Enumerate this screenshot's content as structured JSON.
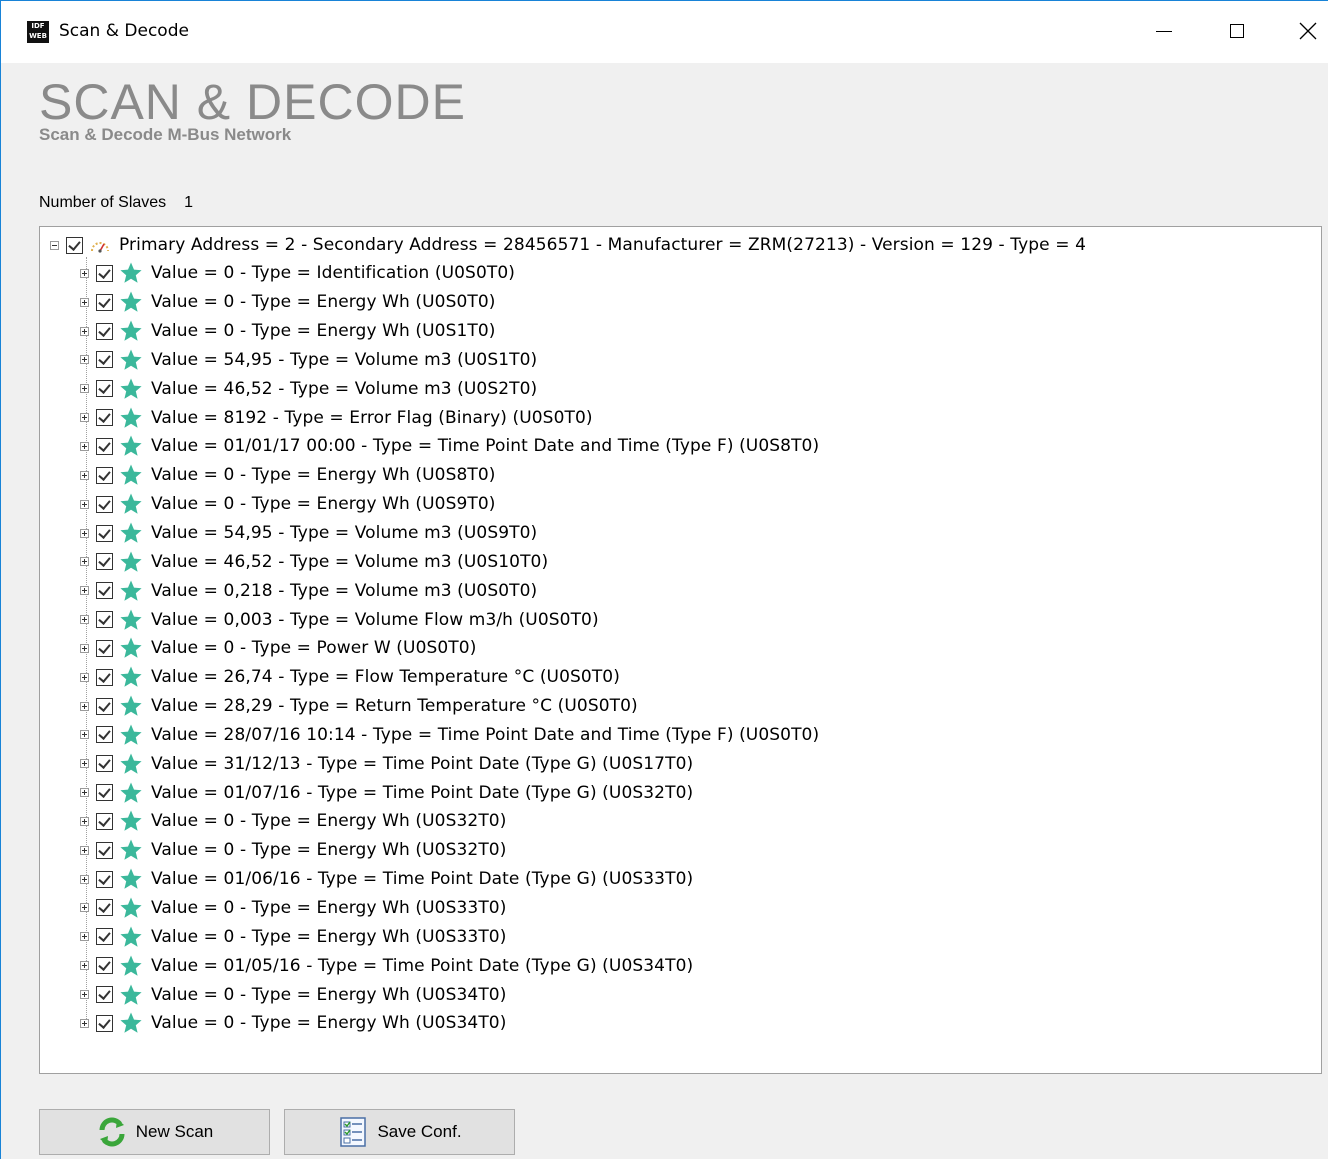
{
  "window": {
    "title": "Scan & Decode",
    "app_icon_lines": [
      "IDF",
      "WEB"
    ],
    "accent": "#1883d7"
  },
  "header": {
    "title": "SCAN & DECODE",
    "subtitle": "Scan & Decode M-Bus Network"
  },
  "slaves": {
    "label": "Number of Slaves",
    "count": "1"
  },
  "tree": {
    "root": "Primary Address = 2 - Secondary Address = 28456571 - Manufacturer = ZRM(27213) - Version = 129 - Type = 4",
    "items": [
      "Value = 0 - Type = Identification (U0S0T0)",
      "Value = 0 - Type = Energy Wh (U0S0T0)",
      "Value = 0 - Type = Energy Wh (U0S1T0)",
      "Value = 54,95 - Type = Volume m3 (U0S1T0)",
      "Value = 46,52 - Type = Volume m3 (U0S2T0)",
      "Value = 8192 - Type = Error Flag (Binary) (U0S0T0)",
      "Value = 01/01/17 00:00 - Type = Time Point Date and Time (Type F) (U0S8T0)",
      "Value = 0 - Type = Energy Wh (U0S8T0)",
      "Value = 0 - Type = Energy Wh (U0S9T0)",
      "Value = 54,95 - Type = Volume m3 (U0S9T0)",
      "Value = 46,52 - Type = Volume m3 (U0S10T0)",
      "Value = 0,218 - Type = Volume m3 (U0S0T0)",
      "Value = 0,003 - Type = Volume Flow m3/h (U0S0T0)",
      "Value = 0 - Type = Power W (U0S0T0)",
      "Value = 26,74 - Type = Flow Temperature °C (U0S0T0)",
      "Value = 28,29 - Type = Return Temperature °C (U0S0T0)",
      "Value = 28/07/16 10:14 - Type = Time Point Date and Time (Type F) (U0S0T0)",
      "Value = 31/12/13 - Type = Time Point Date (Type G) (U0S17T0)",
      "Value = 01/07/16 - Type = Time Point Date (Type G) (U0S32T0)",
      "Value = 0 - Type = Energy Wh (U0S32T0)",
      "Value = 0 - Type = Energy Wh (U0S32T0)",
      "Value = 01/06/16 - Type = Time Point Date (Type G) (U0S33T0)",
      "Value = 0 - Type = Energy Wh (U0S33T0)",
      "Value = 0 - Type = Energy Wh (U0S33T0)",
      "Value = 01/05/16 - Type = Time Point Date (Type G) (U0S34T0)",
      "Value = 0 - Type = Energy Wh (U0S34T0)",
      "Value = 0 - Type = Energy Wh (U0S34T0)"
    ],
    "star_color": "#3bb89b"
  },
  "buttons": {
    "new_scan": "New Scan",
    "save_conf": "Save Conf."
  }
}
